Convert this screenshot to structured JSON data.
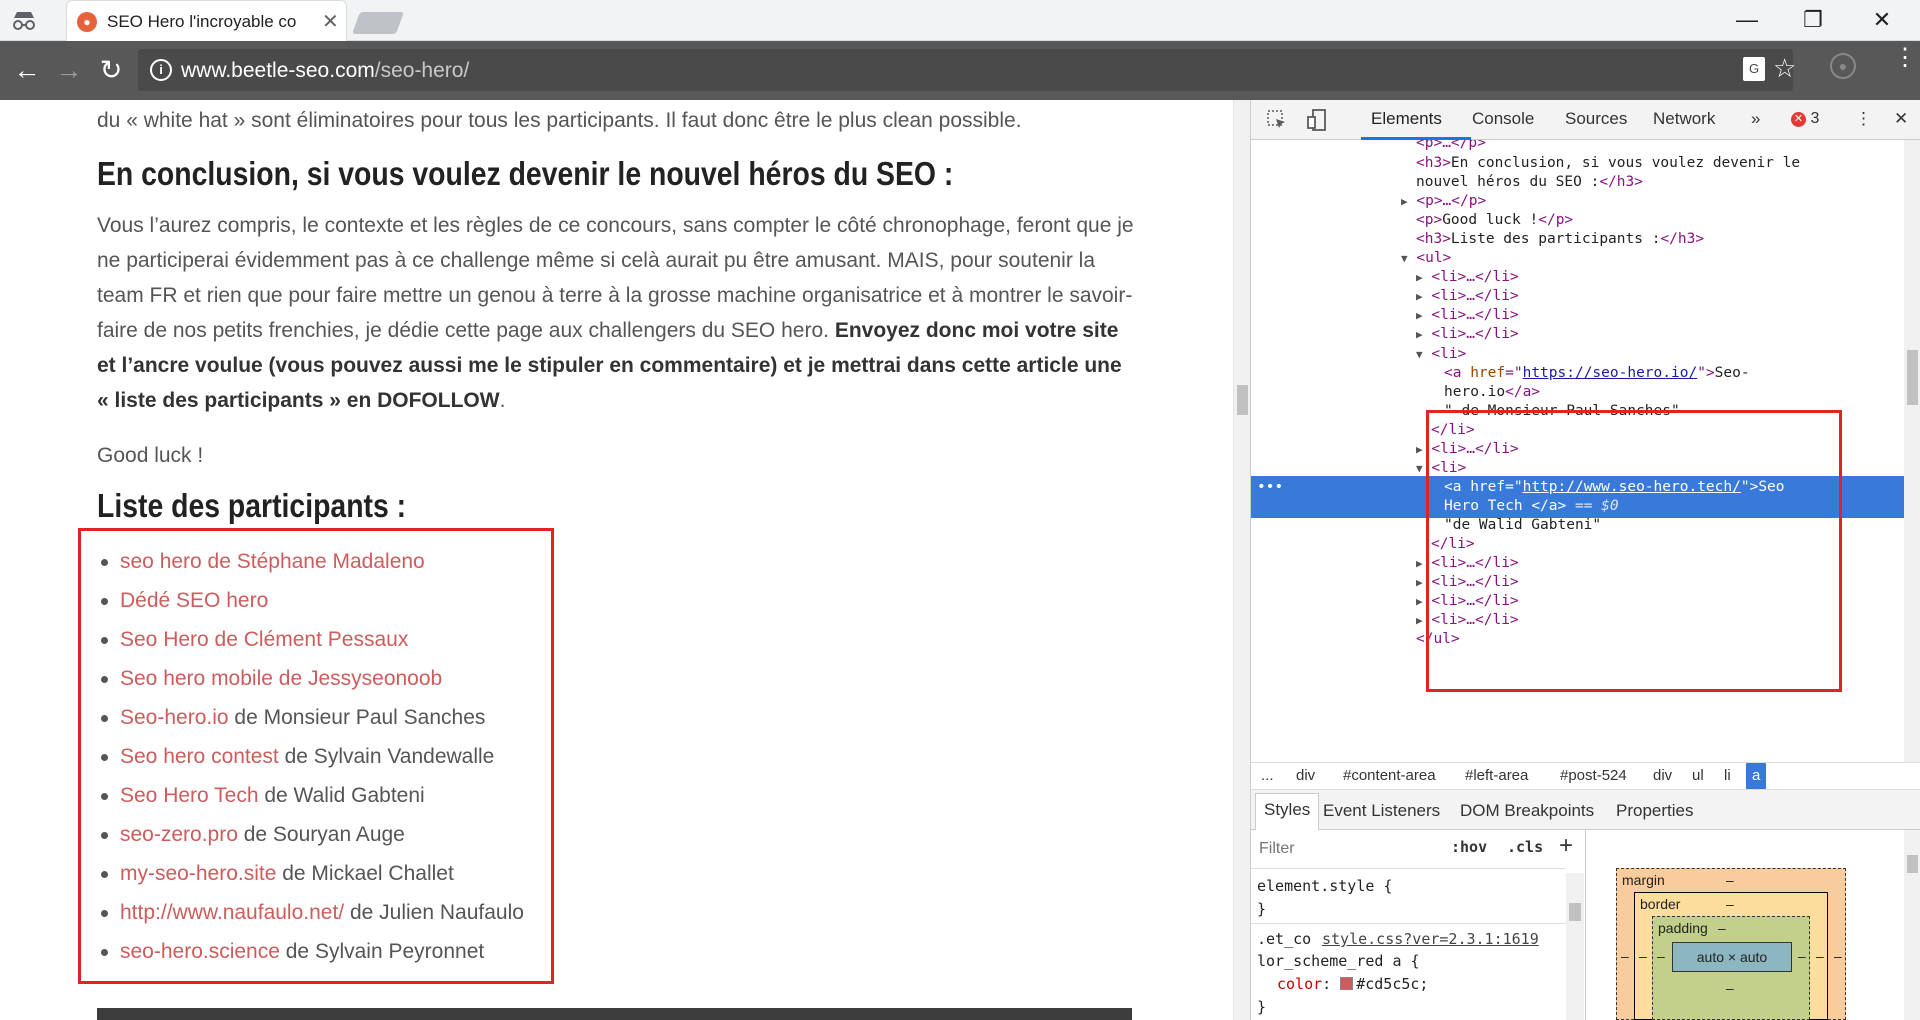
{
  "browser": {
    "tab_title": "SEO Hero l'incroyable co",
    "tab_close": "✕",
    "url_host": "www.beetle-seo.com",
    "url_path": "/seo-hero/",
    "win_minimize": "—",
    "win_restore": "❐",
    "win_close": "✕",
    "back": "←",
    "forward": "→",
    "reload": "↻",
    "info": "i",
    "translate": "G",
    "star": "☆",
    "menu": "⋮"
  },
  "article": {
    "intro_text": "du « white hat » sont éliminatoires pour tous les participants. Il faut donc être le plus clean possible.",
    "heading_conclusion": "En conclusion, si vous voulez devenir le nouvel héros du SEO :",
    "para_part1": "Vous l’aurez compris, le contexte et les règles de ce concours, sans compter le côté chronophage, feront que je ne participerai évidemment pas à ce challenge même si celà aurait pu être amusant. MAIS, pour soutenir la team FR et rien que pour faire mettre un genou à terre à la grosse machine organisatrice et à montrer le savoir-faire de nos petits frenchies, je dédie cette page aux challengers du SEO hero.",
    "para_bold": "Envoyez donc moi votre site et l’ancre voulue (vous pouvez aussi me le stipuler en commentaire)  et je mettrai dans cette article une « liste des participants » en DOFOLLOW",
    "para_end": ".",
    "good_luck": "Good luck !",
    "heading_list": "Liste des participants :",
    "participants": [
      {
        "link": "seo hero de Stéphane Madaleno",
        "rest": ""
      },
      {
        "link": "Dédé SEO hero",
        "rest": ""
      },
      {
        "link": "Seo Hero de Clément Pessaux",
        "rest": ""
      },
      {
        "link": "Seo hero mobile de Jessyseonoob",
        "rest": ""
      },
      {
        "link": "Seo-hero.io",
        "rest": " de Monsieur Paul Sanches"
      },
      {
        "link": "Seo hero contest",
        "rest": " de Sylvain Vandewalle"
      },
      {
        "link": "Seo Hero Tech",
        "rest": " de Walid Gabteni"
      },
      {
        "link": "seo-zero.pro",
        "rest": " de Souryan Auge"
      },
      {
        "link": "my-seo-hero.site",
        "rest": " de Mickael Challet"
      },
      {
        "link": "http://www.naufaulo.net/",
        "rest": " de Julien Naufaulo"
      },
      {
        "link": "seo-hero.science",
        "rest": " de Sylvain Peyronnet"
      }
    ]
  },
  "devtools": {
    "tabs": [
      "Elements",
      "Console",
      "Sources",
      "Network"
    ],
    "more": "»",
    "error_count": "3",
    "error_icon": "✕",
    "menu": "⋮",
    "close": "✕",
    "dom_lines": {
      "l0": "<p>…</p>",
      "l1a": "<h3>",
      "l1b": "En conclusion, si vous voulez devenir le",
      "l2a": "nouvel héros du SEO :",
      "l2b": "</h3>",
      "l3": "<p>…</p>",
      "l4a": "<p>",
      "l4b": "Good luck !",
      "l4c": "</p>",
      "l5a": "<h3>",
      "l5b": "Liste des participants :",
      "l5c": "</h3>",
      "l6": "<ul>",
      "li_collapsed": "<li>…</li>",
      "li_open": "<li>",
      "a_open": "<a ",
      "href": "href",
      "eq": "=\"",
      "href1": "https://seo-hero.io/",
      "q_close": "\">",
      "text1a": "Seo-",
      "text1b": "hero.io",
      "a_close": "</a>",
      "text1c": "\" de Monsieur Paul Sanches\"",
      "li_close": "</li>",
      "href2": "http://www.seo-hero.tech/",
      "text2a": "Seo",
      "text2b": "Hero Tech ",
      "eq0": " == $0",
      "text2c": "\"de Walid Gabteni\"",
      "ul_close": "</ul>",
      "ellipsis": "•••"
    },
    "breadcrumbs": [
      "...",
      "div",
      "#content-area",
      "#left-area",
      "#post-524",
      "div",
      "ul",
      "li",
      "a"
    ],
    "subtabs": [
      "Styles",
      "Event Listeners",
      "DOM Breakpoints",
      "Properties"
    ],
    "filter_placeholder": "Filter",
    "hov": ":hov",
    "cls": ".cls",
    "plus": "+",
    "styles": {
      "element_style": "element.style {",
      "close_brace": "}",
      "sel1": ".et_co",
      "link": "style.css?ver=2.3.1:1619",
      "sel2": "lor_scheme_red a {",
      "prop": "color",
      "value": "#cd5c5c;",
      "swatch_color": "#cd5c5c"
    },
    "boxmodel": {
      "margin": "margin",
      "border": "border",
      "padding": "padding",
      "dash": "–",
      "content": "auto × auto"
    }
  }
}
